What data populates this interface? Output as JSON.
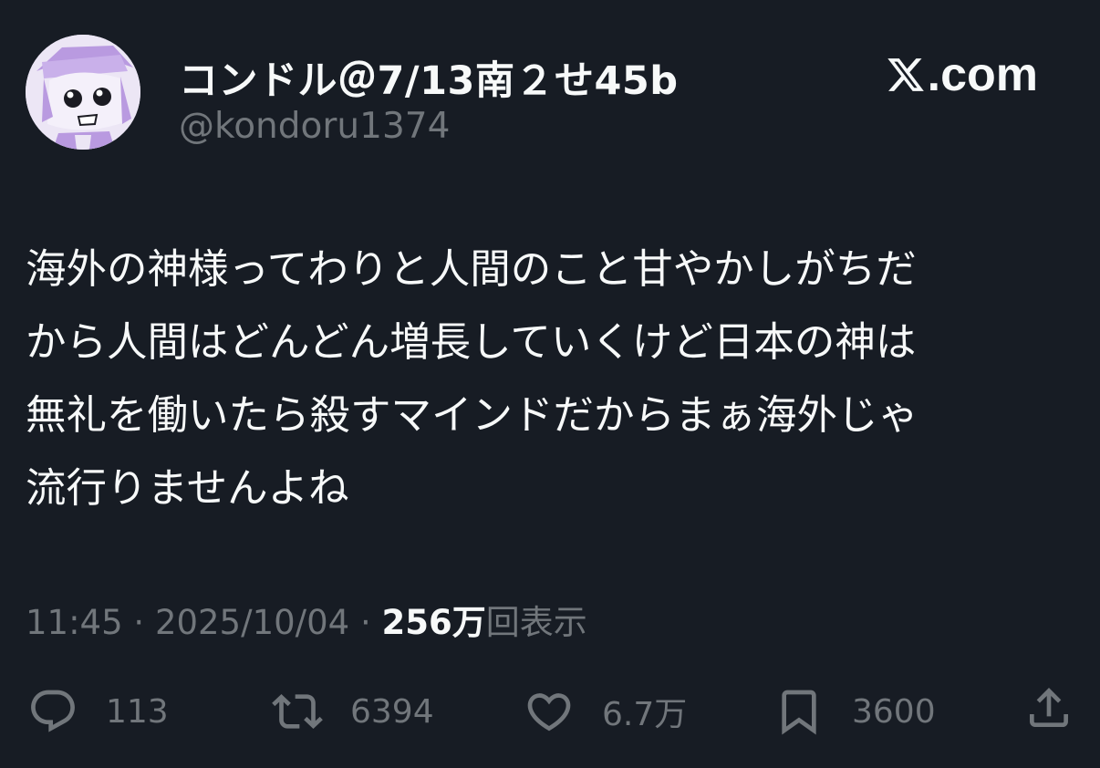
{
  "author": {
    "display_name": "コンドル＠7/13南２せ45b",
    "handle": "@kondoru1374",
    "avatar_icon": "character-avatar-icon"
  },
  "brand": {
    "text": ".com",
    "logo_icon": "x-logo-icon"
  },
  "tweet": {
    "text": "海外の神様ってわりと人間のこと甘やかしがちだ\nから人間はどんどん増長していくけど日本の神は\n無礼を働いたら殺すマインドだからまぁ海外じゃ\n流行りませんよね"
  },
  "meta": {
    "time": "11:45",
    "separator": " · ",
    "date": "2025/10/04",
    "views_count": "256万",
    "views_label": "回表示"
  },
  "actions": {
    "replies": {
      "icon": "reply-icon",
      "count": "113"
    },
    "reposts": {
      "icon": "repost-icon",
      "count": "6394"
    },
    "likes": {
      "icon": "heart-icon",
      "count": "6.7万"
    },
    "bookmarks": {
      "icon": "bookmark-icon",
      "count": "3600"
    },
    "share": {
      "icon": "share-icon"
    }
  },
  "colors": {
    "background": "#171c24",
    "text_primary": "#f7f9f9",
    "text_secondary": "#71767b",
    "avatar_bg": "#e6def2",
    "avatar_accent": "#b08fd8"
  }
}
